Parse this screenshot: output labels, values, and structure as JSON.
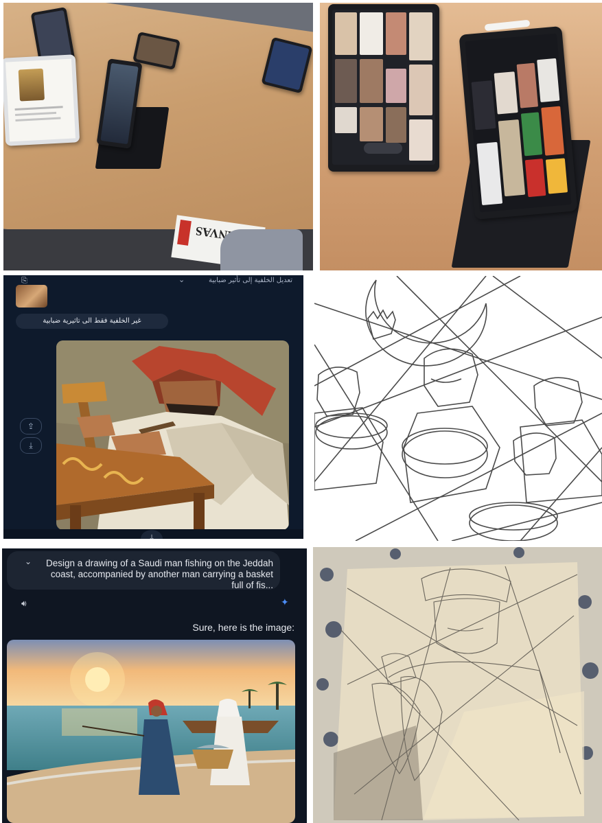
{
  "panel_photo_classroom": {
    "magazine_title": "CANVAS"
  },
  "panel_chat_arabic": {
    "top_title": "تعديل الخلفية إلى تأثير ضبابية",
    "prompt": "غير الخلفية فقط الى تاثيرية ضبابية",
    "icons": [
      "document-icon",
      "chevron-down-icon",
      "share-icon",
      "download-icon"
    ]
  },
  "panel_chat_english": {
    "prompt": "Design a drawing of a Saudi man fishing on the Jeddah coast, accompanied by another man carrying a basket full of fis...",
    "reply": "Sure, here is the image:",
    "icons": [
      "chevron-down-icon",
      "speaker-icon",
      "sparkle-icon",
      "star-icon"
    ],
    "colors": {
      "sparkle": "#4c8df6"
    }
  }
}
